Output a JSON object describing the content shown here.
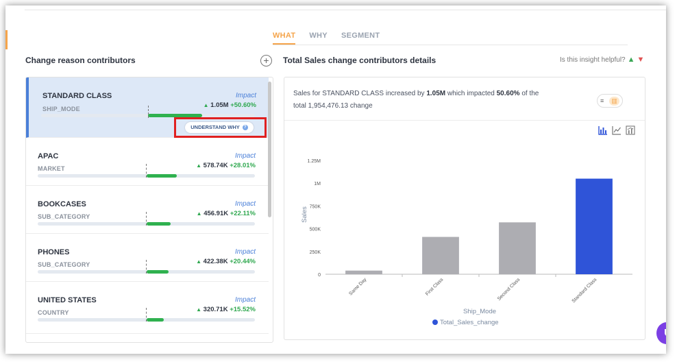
{
  "tabs": [
    {
      "label": "WHAT",
      "active": true
    },
    {
      "label": "WHY",
      "active": false
    },
    {
      "label": "SEGMENT",
      "active": false
    }
  ],
  "left_panel": {
    "title": "Change reason contributors",
    "add_icon": "plus-circle-icon"
  },
  "contributors": [
    {
      "title": "STANDARD CLASS",
      "subtitle": "SHIP_MODE",
      "impact_label": "Impact",
      "arrow": "▲",
      "amount": "1.05M",
      "percent": "+50.60%",
      "share": 0.506,
      "selected": true
    },
    {
      "title": "APAC",
      "subtitle": "MARKET",
      "impact_label": "Impact",
      "arrow": "▲",
      "amount": "578.74K",
      "percent": "+28.01%",
      "share": 0.2801,
      "selected": false
    },
    {
      "title": "BOOKCASES",
      "subtitle": "SUB_CATEGORY",
      "impact_label": "Impact",
      "arrow": "▲",
      "amount": "456.91K",
      "percent": "+22.11%",
      "share": 0.2211,
      "selected": false
    },
    {
      "title": "PHONES",
      "subtitle": "SUB_CATEGORY",
      "impact_label": "Impact",
      "arrow": "▲",
      "amount": "422.38K",
      "percent": "+20.44%",
      "share": 0.2044,
      "selected": false
    },
    {
      "title": "UNITED STATES",
      "subtitle": "COUNTRY",
      "impact_label": "Impact",
      "arrow": "▲",
      "amount": "320.71K",
      "percent": "+15.52%",
      "share": 0.1552,
      "selected": false
    }
  ],
  "understand_why": {
    "label": "UNDERSTAND WHY",
    "help_icon": "?"
  },
  "right_panel": {
    "title": "Total Sales change contributors details",
    "helpful_prompt": "Is this insight helpful?",
    "thumb_up": "👍",
    "thumb_down": "👎"
  },
  "summary": {
    "p1": "Sales for STANDARD CLASS increased by ",
    "amount": "1.05M",
    "p2": " which impacted ",
    "percent": "50.60%",
    "p3": " of the total 1,954,476.13 change"
  },
  "toggle": {
    "list_icon": "≡",
    "chart_icon": "▥"
  },
  "chart_data": {
    "type": "bar",
    "categories": [
      "Same Day",
      "First Class",
      "Second Class",
      "Standard Class"
    ],
    "values": [
      40000,
      410000,
      570000,
      1050000
    ],
    "highlight_index": 3,
    "xlabel": "Ship_Mode",
    "ylabel": "Sales",
    "yticks": [
      "0",
      "250K",
      "500K",
      "750K",
      "1M",
      "1.25M"
    ],
    "ylim": [
      0,
      1250000
    ],
    "legend": "Total_Sales_change",
    "colors": {
      "default": "#adadb2",
      "highlight": "#2f54d8"
    },
    "grid": false,
    "legend_position": "bottom"
  }
}
